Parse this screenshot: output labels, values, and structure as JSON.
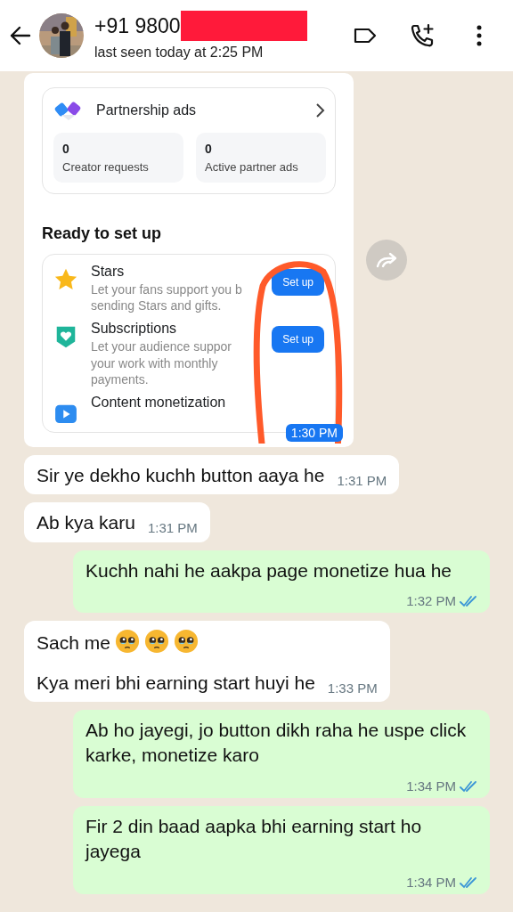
{
  "header": {
    "name": "+91 9800",
    "status": "last seen today at 2:25 PM"
  },
  "image_message": {
    "screenshot": {
      "partnership": {
        "title": "Partnership ads",
        "stats": [
          {
            "value": "0",
            "label": "Creator requests"
          },
          {
            "value": "0",
            "label": "Active partner ads"
          }
        ]
      },
      "section_title": "Ready to set up",
      "items": [
        {
          "kind": "star",
          "title": "Stars",
          "description": "Let your fans support you b\nsending Stars and gifts.",
          "button": "Set up"
        },
        {
          "kind": "heart",
          "title": "Subscriptions",
          "description": "Let your audience suppor\nyour work with monthly\npayments.",
          "button": "Set up"
        },
        {
          "kind": "play",
          "title": "Content monetization"
        }
      ]
    },
    "time": "1:30 PM"
  },
  "messages": [
    {
      "kind": "incoming",
      "paragraphs": [
        {
          "text": "Sir ye dekho kuchh button aaya he"
        }
      ],
      "time": "1:31 PM"
    },
    {
      "kind": "incoming",
      "paragraphs": [
        {
          "text": "Ab kya karu"
        }
      ],
      "time": "1:31 PM"
    },
    {
      "kind": "outgoing",
      "paragraphs": [
        {
          "text": "Kuchh nahi he aakpa page monetize hua he"
        }
      ],
      "time": "1:32 PM",
      "read": true
    },
    {
      "kind": "incoming",
      "paragraphs": [
        {
          "text": "Sach me",
          "icons": [
            {
              "kind": "pleading-face"
            },
            {
              "kind": "pleading-face"
            },
            {
              "kind": "pleading-face"
            }
          ]
        },
        {
          "text": "Kya meri bhi earning start huyi he"
        }
      ],
      "time": "1:33 PM"
    },
    {
      "kind": "outgoing",
      "paragraphs": [
        {
          "text": "Ab ho jayegi, jo button dikh raha he uspe click karke, monetize karo"
        }
      ],
      "time": "1:34 PM",
      "read": true
    },
    {
      "kind": "outgoing",
      "paragraphs": [
        {
          "text": "Fir 2 din baad aapka bhi earning start ho jayega"
        }
      ],
      "time": "1:34 PM",
      "read": true
    }
  ]
}
